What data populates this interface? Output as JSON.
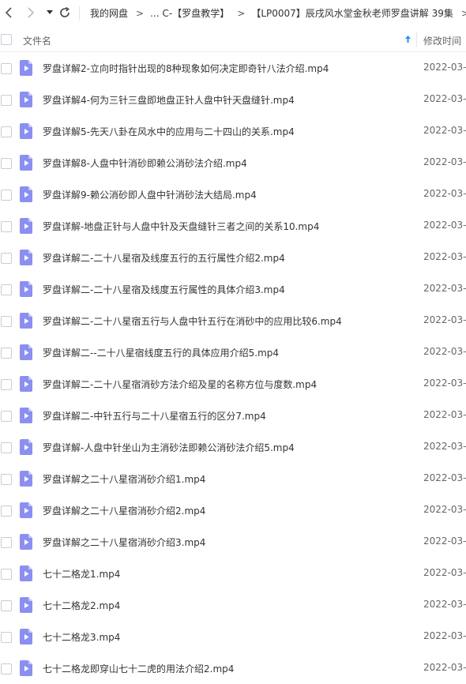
{
  "toolbar": {
    "breadcrumbs": [
      "我的网盘",
      "...",
      "C-【罗盘教学】",
      "【LP0007】辰戌风水堂金秋老师罗盘讲解 39集"
    ]
  },
  "header": {
    "name_label": "文件名",
    "time_label": "修改时间"
  },
  "colors": {
    "icon_purple": "#8b8ff2",
    "icon_fold": "#c2c5fa",
    "sort_arrow_blue": "#2b8cf4"
  },
  "files": [
    {
      "name": "罗盘详解2-立向时指针出现的8种现象如何决定即奇针八法介绍.mp4",
      "time": "2022-03-"
    },
    {
      "name": "罗盘详解4-何为三针三盘即地盘正针人盘中针天盘缝针.mp4",
      "time": "2022-03-"
    },
    {
      "name": "罗盘详解5-先天八卦在风水中的应用与二十四山的关系.mp4",
      "time": "2022-03-"
    },
    {
      "name": "罗盘详解8-人盘中针消砂即赖公消砂法介绍.mp4",
      "time": "2022-03-"
    },
    {
      "name": "罗盘详解9-赖公消砂即人盘中针消砂法大结局.mp4",
      "time": "2022-03-"
    },
    {
      "name": "罗盘详解-地盘正针与人盘中针及天盘缝针三者之间的关系10.mp4",
      "time": "2022-03-"
    },
    {
      "name": "罗盘详解二-二十八星宿及线度五行的五行属性介绍2.mp4",
      "time": "2022-03-"
    },
    {
      "name": "罗盘详解二-二十八星宿及线度五行属性的具体介绍3.mp4",
      "time": "2022-03-"
    },
    {
      "name": "罗盘详解二-二十八星宿五行与人盘中针五行在消砂中的应用比较6.mp4",
      "time": "2022-03-"
    },
    {
      "name": "罗盘详解二--二十八星宿线度五行的具体应用介绍5.mp4",
      "time": "2022-03-"
    },
    {
      "name": "罗盘详解二-二十八星宿消砂方法介绍及星的名称方位与度数.mp4",
      "time": "2022-03-"
    },
    {
      "name": "罗盘详解二-中针五行与二十八星宿五行的区分7.mp4",
      "time": "2022-03-"
    },
    {
      "name": "罗盘详解-人盘中针坐山为主消砂法即赖公消砂法介绍5.mp4",
      "time": "2022-03-"
    },
    {
      "name": "罗盘详解之二十八星宿消砂介绍1.mp4",
      "time": "2022-03-"
    },
    {
      "name": "罗盘详解之二十八星宿消砂介绍2.mp4",
      "time": "2022-03-"
    },
    {
      "name": "罗盘详解之二十八星宿消砂介绍3.mp4",
      "time": "2022-03-"
    },
    {
      "name": "七十二格龙1.mp4",
      "time": "2022-03-"
    },
    {
      "name": "七十二格龙2.mp4",
      "time": "2022-03-"
    },
    {
      "name": "七十二格龙3.mp4",
      "time": "2022-03-"
    },
    {
      "name": "七十二格龙即穿山七十二虎的用法介绍2.mp4",
      "time": "2022-03-"
    }
  ]
}
